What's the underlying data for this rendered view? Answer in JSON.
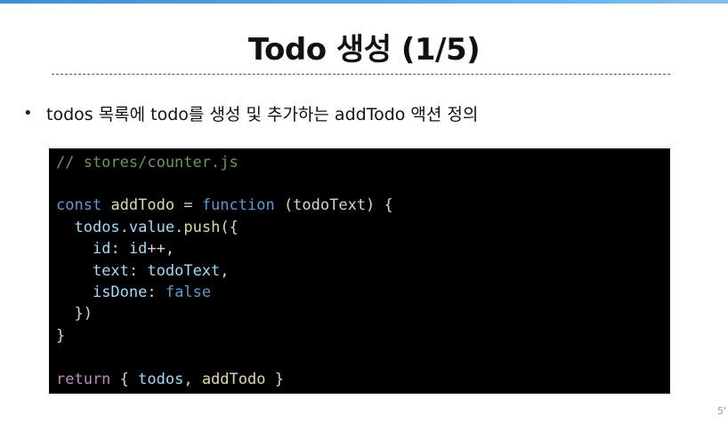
{
  "slide": {
    "title": "Todo 생성 (1/5)",
    "page_number": "5'"
  },
  "bullet": {
    "dot": "•",
    "text": "todos 목록에 todo를 생성 및 추가하는 addTodo 액션 정의"
  },
  "code": {
    "comment": "// stores/counter.js",
    "l_const": "const",
    "l_name": "addTodo",
    "l_eq": " = ",
    "l_function": "function",
    "l_params": " (todoText) {",
    "l2_obj": "todos",
    "l2_dot": ".",
    "l2_prop": "value",
    "l2_dot2": ".",
    "l2_push": "push",
    "l2_open": "({",
    "l3_key": "id",
    "l3_colon": ": ",
    "l3_val": "id",
    "l3_rest": "++,",
    "l4_key": "text",
    "l4_colon": ": ",
    "l4_val": "todoText",
    "l4_comma": ",",
    "l5_key": "isDone",
    "l5_colon": ": ",
    "l5_val": "false",
    "l6": "  })",
    "l7": "}",
    "l8_return": "return",
    "l8_open": " { ",
    "l8_a": "todos",
    "l8_comma": ", ",
    "l8_b": "addTodo",
    "l8_close": " }"
  },
  "colors": {
    "accent_bar": "#3b8fd9",
    "code_bg": "#000000",
    "comment": "#6a9955",
    "keyword": "#569cd6",
    "function_name": "#dcdcaa",
    "variable": "#9cdcfe",
    "control_keyword": "#c586c0"
  }
}
